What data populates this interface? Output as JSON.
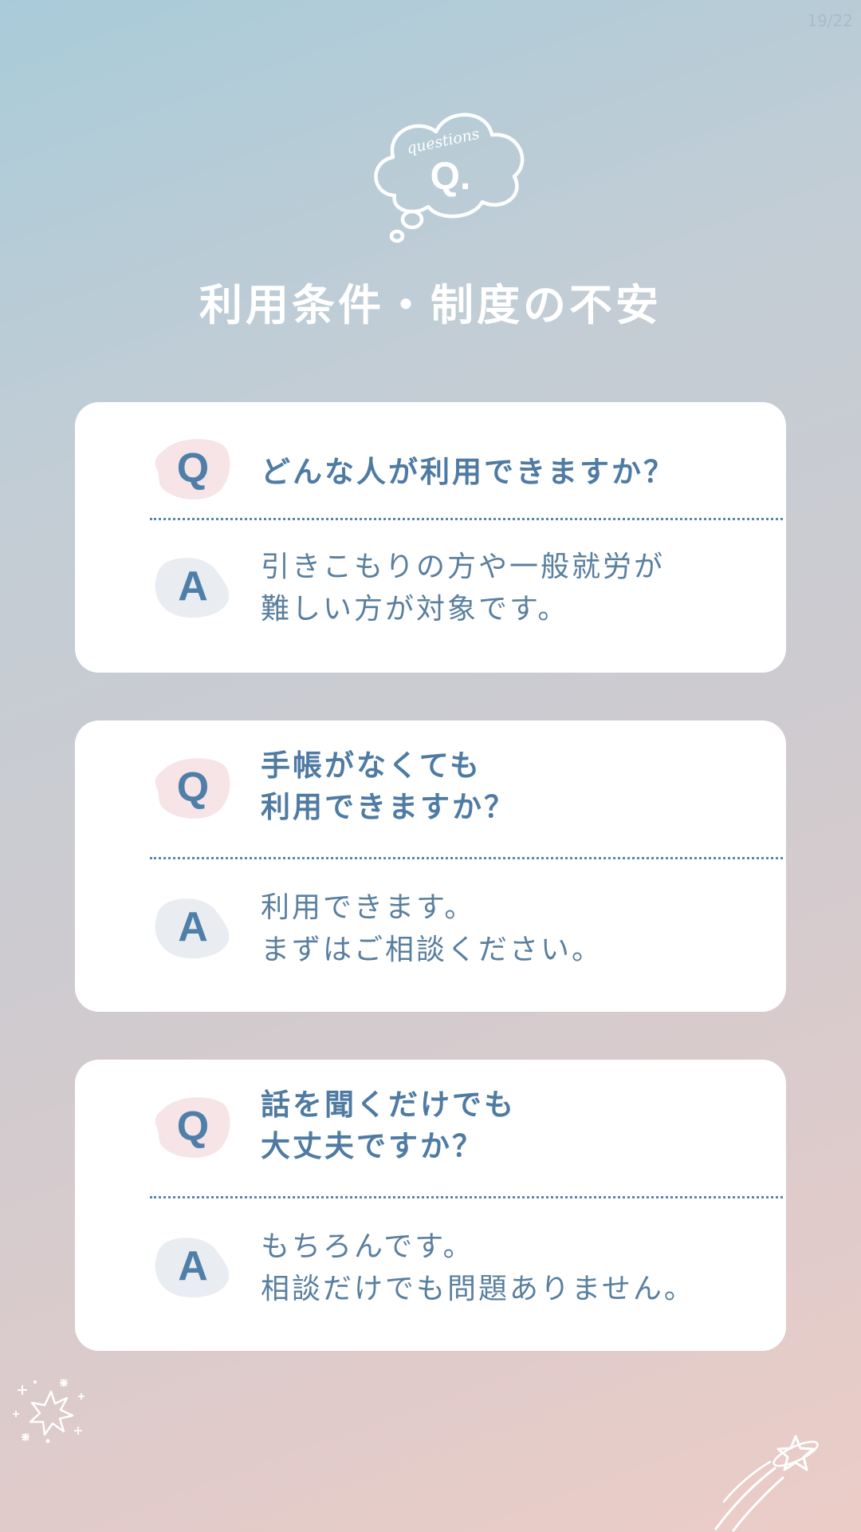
{
  "page_counter": "19/22",
  "header": {
    "cloud_script": "questions",
    "cloud_letter": "Q.",
    "title": "利用条件・制度の不安"
  },
  "qa": [
    {
      "q_badge": "Q",
      "question_lines": [
        "どんな人が利用できますか？"
      ],
      "a_badge": "A",
      "answer_lines": [
        "引きこもりの方や一般就労が",
        "難しい方が対象です。"
      ]
    },
    {
      "q_badge": "Q",
      "question_lines": [
        "手帳がなくても",
        "利用できますか？"
      ],
      "a_badge": "A",
      "answer_lines": [
        "利用できます。",
        "まずはご相談ください。"
      ]
    },
    {
      "q_badge": "Q",
      "question_lines": [
        "話を聞くだけでも",
        "大丈夫ですか？"
      ],
      "a_badge": "A",
      "answer_lines": [
        "もちろんです。",
        "相談だけでも問題ありません。"
      ]
    }
  ],
  "colors": {
    "q_badge_bg": "#f6e4e6",
    "a_badge_bg": "#e9edf1",
    "accent_text": "#4f7ba3"
  },
  "icons": {
    "header": "thought-cloud-icon",
    "bottom_left": "sparkle-star-icon",
    "bottom_right": "shooting-star-icon"
  }
}
